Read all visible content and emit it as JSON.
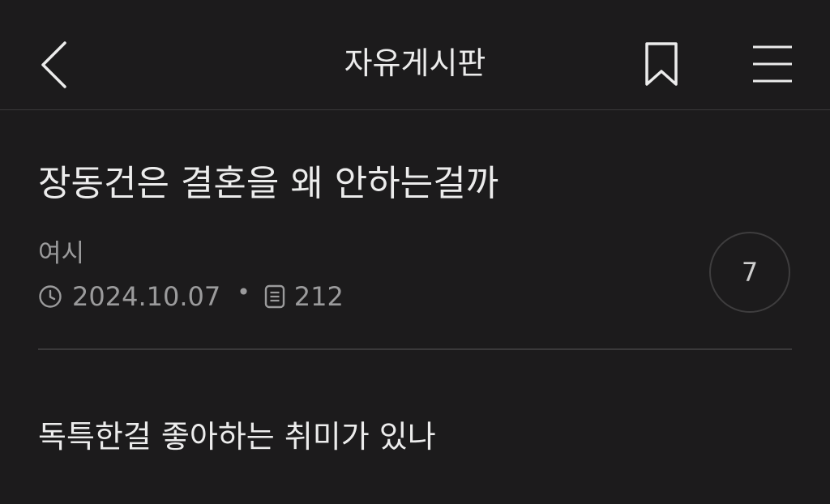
{
  "header": {
    "title": "자유게시판",
    "back_icon": "chevron-left-icon",
    "bookmark_icon": "bookmark-icon",
    "menu_icon": "hamburger-menu-icon"
  },
  "post": {
    "title": "장동건은 결혼을 왜 안하는걸까",
    "author": "여시",
    "date": "2024.10.07",
    "separator": "•",
    "views": "212",
    "comment_count": "7",
    "body": "독특한걸 좋아하는 취미가 있나"
  },
  "colors": {
    "background": "#1c1b1c",
    "text": "#ececec",
    "muted": "#9b9b9c",
    "divider": "#3a393a"
  }
}
